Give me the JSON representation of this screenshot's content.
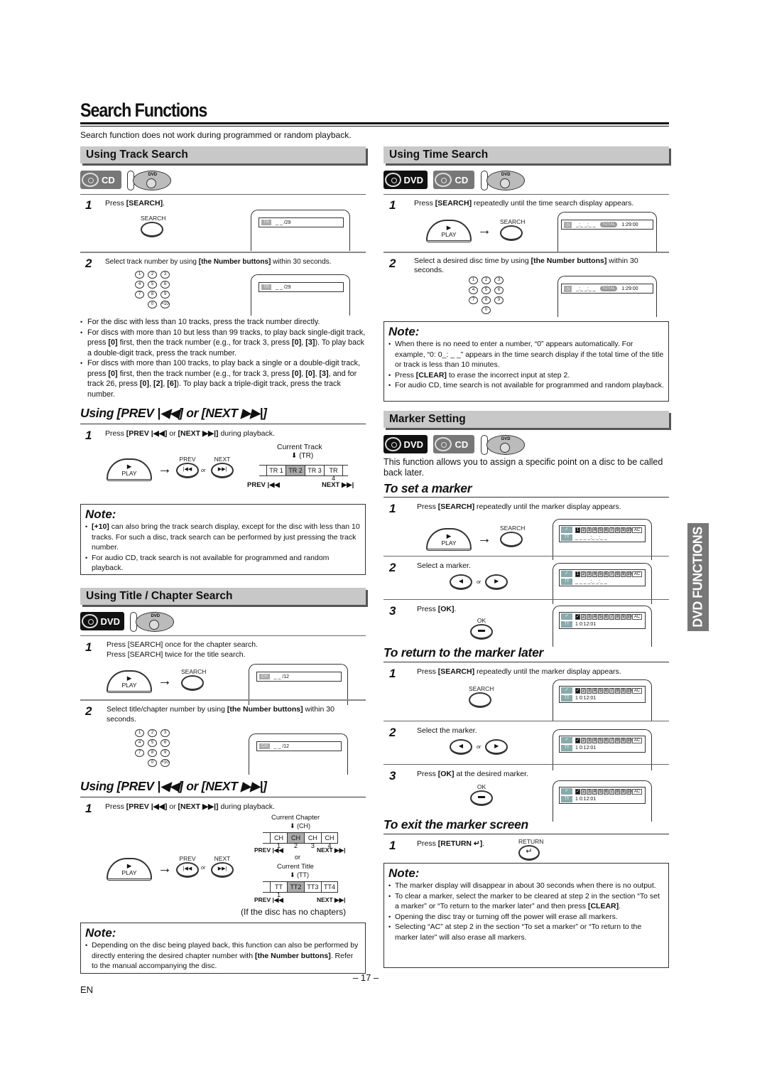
{
  "page": {
    "title": "Search Functions",
    "intro": "Search function does not work during programmed or random playback.",
    "page_number": "– 17 –",
    "language": "EN",
    "side_tab": "DVD FUNCTIONS"
  },
  "common": {
    "search_btn": "SEARCH",
    "play_btn": "PLAY",
    "prev_btn": "PREV",
    "next_btn": "NEXT",
    "or": "or",
    "ok_btn": "OK",
    "return_btn": "RETURN",
    "note_title": "Note:",
    "badge_dvd": "DVD",
    "badge_cd": "CD",
    "tray_label": "DVD",
    "numpad": [
      "1",
      "2",
      "3",
      "4",
      "5",
      "6",
      "7",
      "8",
      "9",
      "0",
      "+10"
    ]
  },
  "track_search": {
    "heading": "Using Track Search",
    "step1_num": "1",
    "step1_pre": "Press ",
    "step1_bold": "[SEARCH]",
    "step1_post": ".",
    "display_icon": "TR",
    "display_value": "_ _ /29",
    "step2_num": "2",
    "step2_pre": "Select track number by using ",
    "step2_bold": "[the Number buttons]",
    "step2_post": " within 30 seconds.",
    "bullets": [
      "For the disc with less than 10 tracks, press the track number directly.",
      "For discs with more than 10 but less than 99 tracks, to play back single-digit track, press [0] first, then the track number (e.g., for track 3, press [0], [3]). To play back a double-digit track, press the track number.",
      "For discs with more than 100 tracks, to play back a single or a double-digit track, press [0] first, then the track number (e.g., for track 3, press [0], [0], [3], and for track 26, press [0], [2], [6]). To play back a triple-digit track, press the track number."
    ]
  },
  "prev_next_track": {
    "heading": "Using [PREV |◀◀] or [NEXT ▶▶|]",
    "step1_num": "1",
    "step1_pre": "Press ",
    "step1_bold1": "[PREV |◀◀]",
    "step1_mid": " or ",
    "step1_bold2": "[NEXT ▶▶|]",
    "step1_post": " during playback.",
    "current_label": "Current Track",
    "current_abbr": "(TR)",
    "cells": [
      "TR 1",
      "TR 2",
      "TR 3",
      "TR 4"
    ],
    "current_index": 1,
    "prev_label": "PREV |◀◀",
    "next_label": "NEXT ▶▶|",
    "note_items": [
      "[+10] can also bring the track search display, except for the disc with less than 10 tracks. For such a disc, track search can be performed by just pressing the track number.",
      "For audio CD, track search is not available for programmed and random playback."
    ]
  },
  "title_chapter": {
    "heading": "Using Title / Chapter Search",
    "step1_num": "1",
    "step1_line1": "Press [SEARCH] once for the chapter search.",
    "step1_line2": "Press [SEARCH] twice for the title search.",
    "display_icon": "CH",
    "display_value": "_ _ /12",
    "step2_num": "2",
    "step2_pre": "Select title/chapter number by using ",
    "step2_bold": "[the Number buttons]",
    "step2_post": " within 30 seconds."
  },
  "prev_next_chapter": {
    "heading": "Using [PREV |◀◀] or [NEXT ▶▶|]",
    "step1_num": "1",
    "step1_pre": "Press ",
    "step1_bold1": "[PREV |◀◀]",
    "step1_mid": " or ",
    "step1_bold2": "[NEXT ▶▶|]",
    "step1_post": " during playback.",
    "chapter_label": "Current Chapter",
    "chapter_abbr": "(CH)",
    "chapter_cells": [
      "CH 1",
      "CH 2",
      "CH 3",
      "CH 4"
    ],
    "title_label": "Current Title",
    "title_abbr": "(TT)",
    "title_cells": [
      "TT 1",
      "TT2",
      "TT3",
      "TT4"
    ],
    "current_index": 1,
    "prev_label": "PREV |◀◀",
    "next_label": "NEXT ▶▶|",
    "or": "or",
    "no_chapters": "(If the disc has no chapters)",
    "note_items": [
      "Depending on the disc being played back, this function can also be performed by directly entering the desired chapter number with [the Number buttons]. Refer to the manual accompanying the disc."
    ]
  },
  "time_search": {
    "heading": "Using Time Search",
    "step1_num": "1",
    "step1_pre": "Press ",
    "step1_bold": "[SEARCH]",
    "step1_post": " repeatedly until the time search display appears.",
    "display_value": "_:_ _:_ _",
    "display_total_label": "TOTAL",
    "display_total": "1:29:00",
    "step2_num": "2",
    "step2_pre": "Select a desired disc time by using ",
    "step2_bold": "[the Number buttons]",
    "step2_post": " within 30 seconds.",
    "note_items": [
      "When there is no need to enter a number, “0” appears automatically. For example, “0: 0_: _ _” appears in the time search display if the total time of the title or track is less than 10 minutes.",
      "Press [CLEAR] to erase the incorrect input at step 2.",
      "For audio CD, time search is not available for programmed and random playback."
    ]
  },
  "marker": {
    "heading": "Marker Setting",
    "description": "This function allows you to assign a specific point on a disc to be called back later.",
    "marker_cells": [
      "1",
      "2",
      "3",
      "4",
      "5",
      "6",
      "7",
      "8",
      "9",
      "10",
      "AC"
    ],
    "set": {
      "heading": "To set a marker",
      "step1_num": "1",
      "step1_pre": "Press ",
      "step1_bold": "[SEARCH]",
      "step1_post": " repeatedly until the marker display appears.",
      "step2_num": "2",
      "step2_text": "Select a marker.",
      "step3_num": "3",
      "step3_pre": "Press ",
      "step3_bold": "[OK]",
      "step3_post": ".",
      "empty_time": "_ _  _ _:_ _:_ _",
      "set_time": "1  0:12:01"
    },
    "return": {
      "heading": "To return to the marker later",
      "step1_num": "1",
      "step1_pre": "Press ",
      "step1_bold": "[SEARCH]",
      "step1_post": " repeatedly until the marker display appears.",
      "step2_num": "2",
      "step2_text": "Select the marker.",
      "step3_num": "3",
      "step3_pre": "Press ",
      "step3_bold": "[OK]",
      "step3_post": " at the desired marker.",
      "time": "1  0:12:01"
    },
    "exit": {
      "heading": "To exit the marker screen",
      "step1_num": "1",
      "step1_pre": "Press ",
      "step1_bold": "[RETURN ↵]",
      "step1_post": "."
    },
    "note_items": [
      "The marker display will disappear in about 30 seconds when there is no output.",
      "To clear a marker, select the marker to be cleared at step 2 in the section “To set a marker” or “To return to the marker later” and then press [CLEAR].",
      "Opening the disc tray or turning off the power will erase all markers.",
      "Selecting “AC” at step 2 in the section “To set a marker” or “To return to the marker later” will also erase all markers."
    ]
  }
}
